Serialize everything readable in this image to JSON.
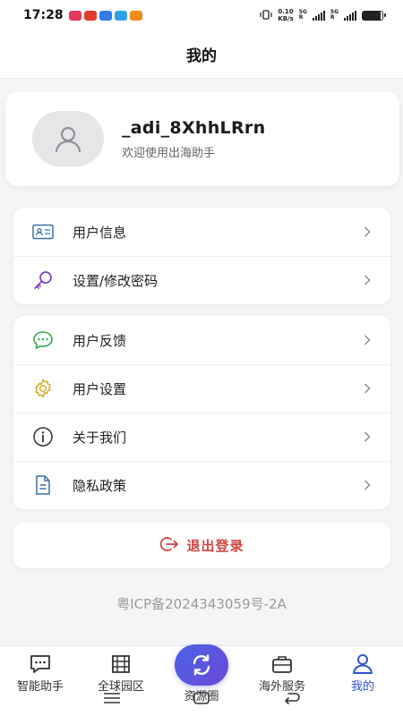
{
  "status": {
    "time": "17:28",
    "speed_value": "0.10",
    "speed_unit": "KB/s",
    "net1": "5G",
    "net2": "5G",
    "battery_percent": 90,
    "app_dot_colors": [
      "#e8365a",
      "#e33b2f",
      "#2f7be8",
      "#2fa1e8",
      "#f08a1c"
    ]
  },
  "header": {
    "title": "我的"
  },
  "profile": {
    "username": "_adi_8XhhLRrn",
    "greeting": "欢迎使用出海助手"
  },
  "menu_group1": [
    {
      "label": "用户信息",
      "icon": "id-card-icon"
    },
    {
      "label": "设置/修改密码",
      "icon": "key-icon"
    }
  ],
  "menu_group2": [
    {
      "label": "用户反馈",
      "icon": "chat-bubble-icon"
    },
    {
      "label": "用户设置",
      "icon": "gear-icon"
    },
    {
      "label": "关于我们",
      "icon": "info-icon"
    },
    {
      "label": "隐私政策",
      "icon": "document-icon"
    }
  ],
  "logout": {
    "label": "退出登录"
  },
  "icp": "粤ICP备2024343059号-2A",
  "tabs": [
    {
      "label": "智能助手",
      "icon": "chat-icon"
    },
    {
      "label": "全球园区",
      "icon": "building-icon"
    },
    {
      "label": "资源圈",
      "icon": "refresh-circle-icon"
    },
    {
      "label": "海外服务",
      "icon": "briefcase-icon"
    },
    {
      "label": "我的",
      "icon": "user-icon"
    }
  ],
  "colors": {
    "accent": "#2f55d4",
    "logout": "#d0433f"
  }
}
